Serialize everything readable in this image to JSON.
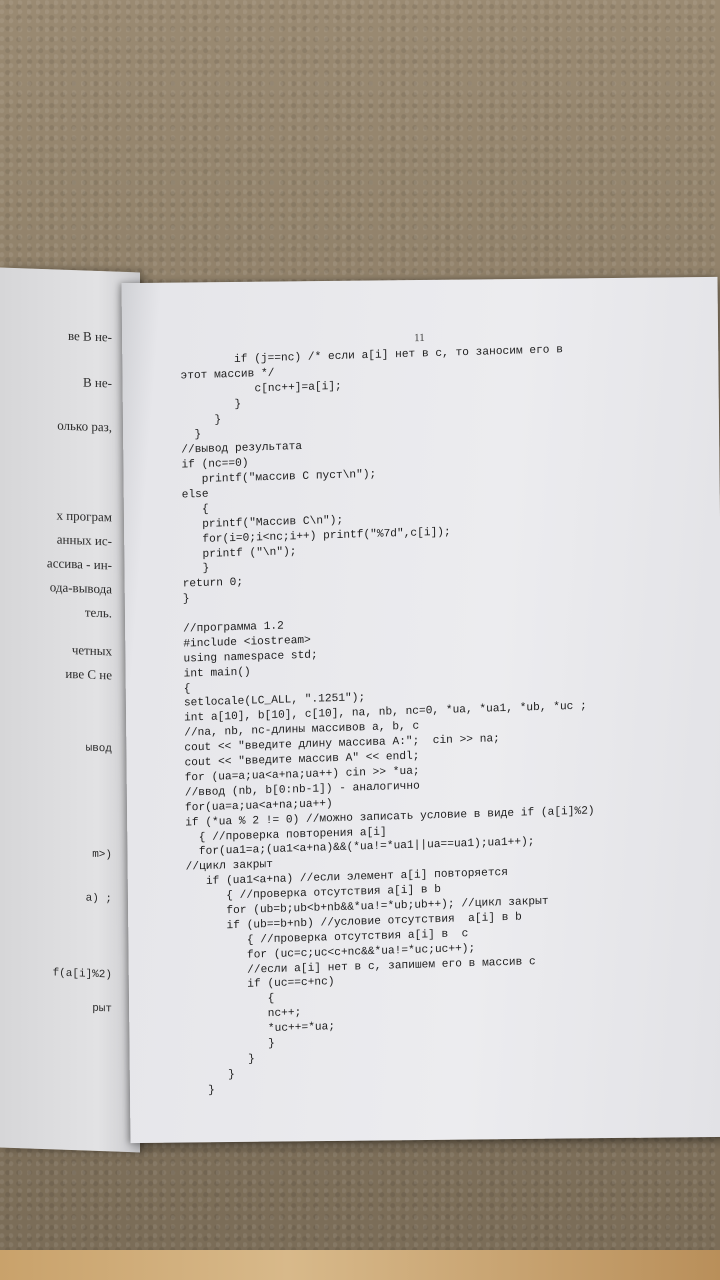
{
  "left_page": {
    "fragments": [
      "ве В не-",
      "В не-",
      "олько раз,",
      "х програм",
      "анных ис-",
      "ассива - ин-",
      "ода-вывода",
      "тель.",
      "четных",
      "иве С не",
      "ывод",
      "m>)",
      "a) ;",
      "f(a[i]%2)",
      "рыт"
    ]
  },
  "right_page": {
    "page_number": "11",
    "code_lines": [
      "        if (j==nc) /* если a[i] нет в c, то заносим его в",
      "этот массив */",
      "           c[nc++]=a[i];",
      "        }",
      "     }",
      "  }",
      "//вывод результата",
      "if (nc==0)",
      "   printf(\"массив С пуст\\n\");",
      "else",
      "   {",
      "   printf(\"Массив С\\n\");",
      "   for(i=0;i<nc;i++) printf(\"%7d\",c[i]);",
      "   printf (\"\\n\");",
      "   }",
      "return 0;",
      "}",
      "",
      "//программа 1.2",
      "#include <iostream>",
      "using namespace std;",
      "int main()",
      "{",
      "setlocale(LC_ALL, \".1251\");",
      "int a[10], b[10], c[10], na, nb, nc=0, *ua, *ua1, *ub, *uc ;",
      "//na, nb, nc-длины массивов a, b, c",
      "cout << \"введите длину массива А:\";  cin >> na;",
      "cout << \"введите массив А\" << endl;",
      "for (ua=a;ua<a+na;ua++) cin >> *ua;",
      "//ввод (nb, b[0:nb-1]) - аналогично",
      "for(ua=a;ua<a+na;ua++)",
      "if (*ua % 2 != 0) //можно записать условие в виде if (a[i]%2)",
      "  { //проверка повторения a[i]",
      "  for(ua1=a;(ua1<a+na)&&(*ua!=*ua1||ua==ua1);ua1++);",
      "//цикл закрыт",
      "   if (ua1<a+na) //если элемент a[i] повторяется",
      "      { //проверка отсутствия a[i] в b",
      "      for (ub=b;ub<b+nb&&*ua!=*ub;ub++); //цикл закрыт",
      "      if (ub==b+nb) //условие отсутствия  a[i] в b",
      "         { //проверка отсутствия a[i] в  c",
      "         for (uc=c;uc<c+nc&&*ua!=*uc;uc++);",
      "         //если a[i] нет в с, запишем его в массив с",
      "         if (uc==c+nc)",
      "            {",
      "            nc++;",
      "            *uc++=*ua;",
      "            }",
      "         }",
      "      }",
      "   }"
    ]
  }
}
